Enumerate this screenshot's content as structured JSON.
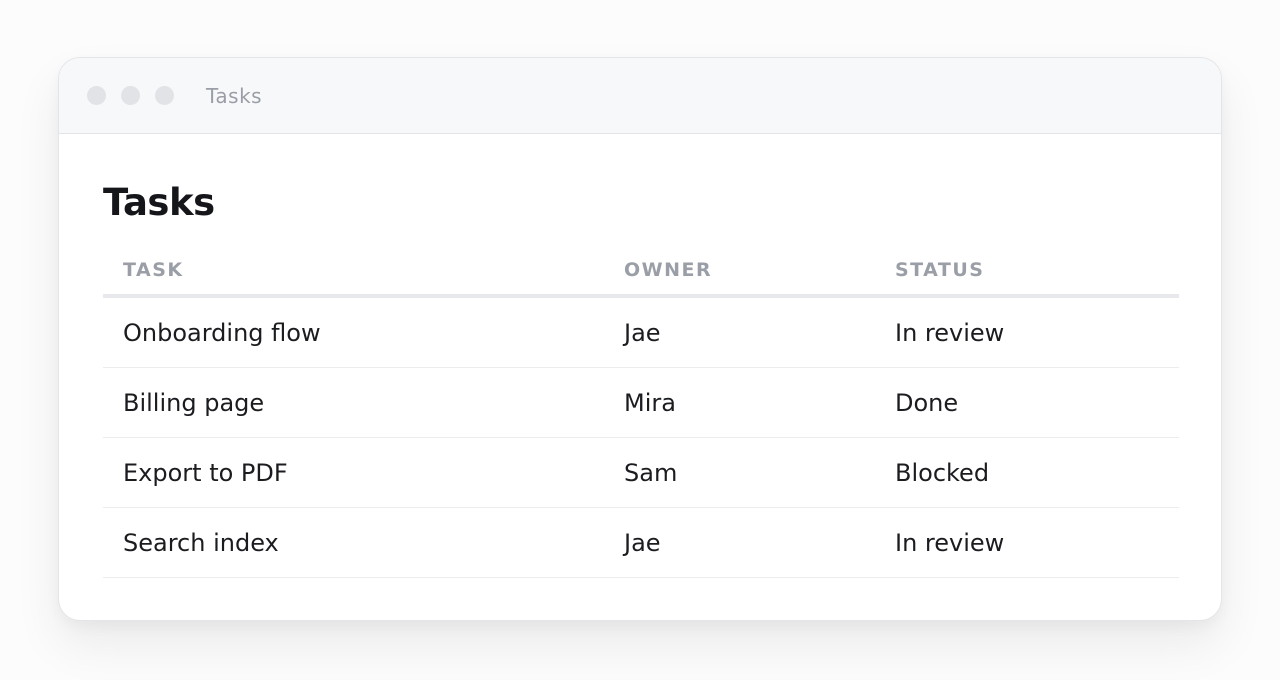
{
  "window": {
    "title": "Tasks"
  },
  "page": {
    "title": "Tasks"
  },
  "table": {
    "headers": [
      "TASK",
      "OWNER",
      "STATUS"
    ],
    "rows": [
      [
        "Onboarding flow",
        "Jae",
        "In review"
      ],
      [
        "Billing page",
        "Mira",
        "Done"
      ],
      [
        "Export to PDF",
        "Sam",
        "Blocked"
      ],
      [
        "Search index",
        "Jae",
        "In review"
      ]
    ]
  },
  "colors": {
    "window_dots": "#e2e3e6",
    "header_text": "#9a9ea6",
    "body_text": "#1b1c20"
  }
}
